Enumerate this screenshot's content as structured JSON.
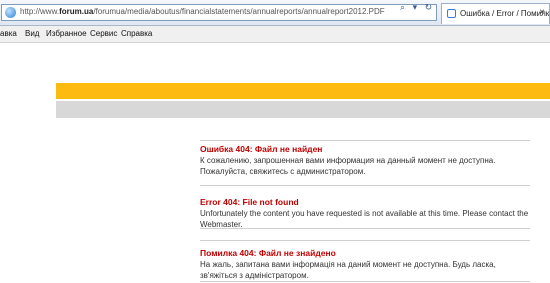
{
  "browser": {
    "url_prefix": "http://www.",
    "url_domain": "forum.ua",
    "url_suffix": "/forumua/media/aboutus/financialstatements/annualreports/annualreport2012.PDF",
    "icons": [
      "search-icon",
      "dropdown-icon",
      "refresh-icon",
      "close-icon"
    ],
    "tab_title": "Ошибка / Error / Помилка",
    "tab_close": "×"
  },
  "menu": {
    "items": [
      "авка",
      "Вид",
      "Избранное",
      "Сервис",
      "Справка"
    ]
  },
  "colors": {
    "banner_yellow": "#fdbb12",
    "banner_grey": "#d8d8d8",
    "error_title": "#c00000"
  },
  "errors": [
    {
      "title": "Ошибка 404: Файл не найден",
      "body": "К сожалению, запрошенная вами информация на данный момент не доступна. Пожалуйста, свяжитесь с администратором."
    },
    {
      "title": "Error 404: File not found",
      "body": "Unfortunately the content you have requested is not available at this time. Please contact the Webmaster."
    },
    {
      "title": "Помилка 404: Файл не знайдено",
      "body": "На жаль, запитана вами інформація на даний момент не доступна. Будь ласка, зв'яжіться з адміністратором."
    }
  ]
}
